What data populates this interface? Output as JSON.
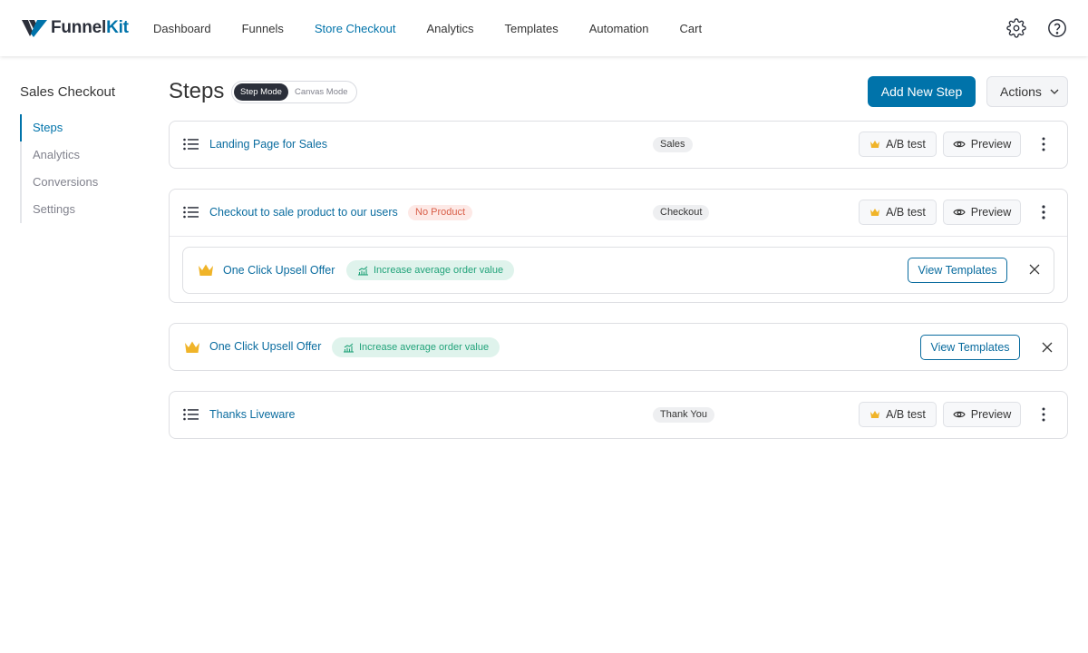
{
  "brand": {
    "name_part1": "Funnel",
    "name_part2": "Kit",
    "accent": "#0073aa"
  },
  "nav": {
    "items": [
      "Dashboard",
      "Funnels",
      "Store Checkout",
      "Analytics",
      "Templates",
      "Automation",
      "Cart"
    ],
    "active": "Store Checkout",
    "icons": [
      "gear-icon",
      "help-icon"
    ]
  },
  "sidebar": {
    "title": "Sales Checkout",
    "items": [
      "Steps",
      "Analytics",
      "Conversions",
      "Settings"
    ],
    "active": "Steps"
  },
  "header": {
    "title": "Steps",
    "modes": [
      "Step Mode",
      "Canvas Mode"
    ],
    "active_mode": "Step Mode",
    "add_button": "Add New Step",
    "actions_button": "Actions"
  },
  "common": {
    "ab_label": "A/B test",
    "preview_label": "Preview",
    "view_templates_label": "View Templates"
  },
  "steps": [
    {
      "name": "Landing Page for Sales",
      "type": "Sales"
    },
    {
      "name": "Checkout to sale product to our users",
      "warning": "No Product",
      "type": "Checkout",
      "offer": {
        "name": "One Click Upsell Offer",
        "badge": "Increase average order value"
      }
    },
    {
      "offer": {
        "name": "One Click Upsell Offer",
        "badge": "Increase average order value"
      }
    },
    {
      "name": "Thanks Liveware",
      "type": "Thank You"
    }
  ]
}
